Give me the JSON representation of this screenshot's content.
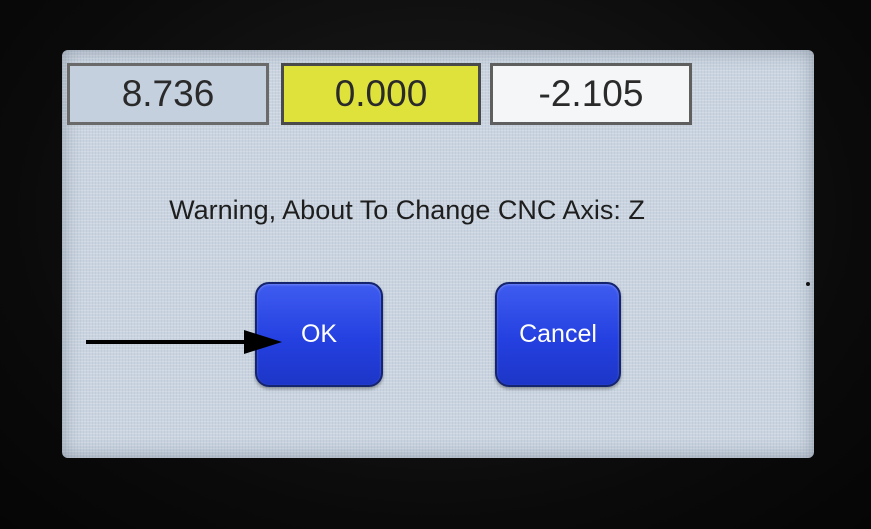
{
  "coordinates": {
    "x": "8.736",
    "y": "0.000",
    "z": "-2.105"
  },
  "dialog": {
    "message": "Warning, About To Change CNC Axis: Z",
    "ok_label": "OK",
    "cancel_label": "Cancel"
  },
  "colors": {
    "button_blue": "#2440e0",
    "highlight_yellow": "#dfe23a",
    "screen_background": "#c9d4e0"
  },
  "annotation": {
    "pointer": "arrow pointing to OK button"
  }
}
